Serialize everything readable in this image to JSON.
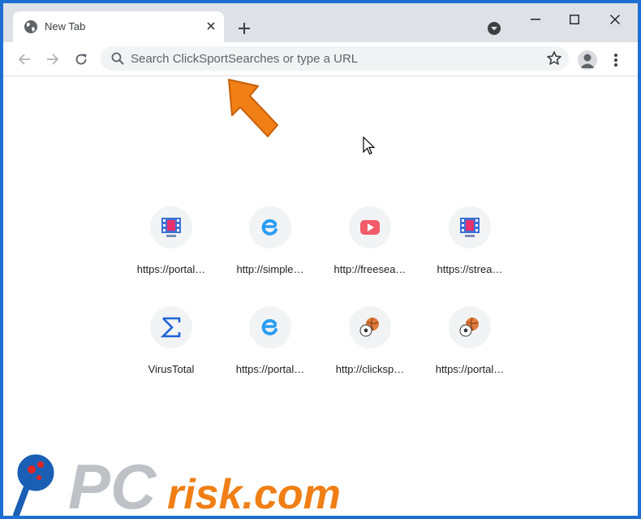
{
  "browser": {
    "tab": {
      "title": "New Tab"
    },
    "omnibox": {
      "placeholder": "Search ClickSportSearches or type a URL"
    }
  },
  "shortcuts": [
    {
      "label": "https://portal…",
      "icon": "film-monitor-icon"
    },
    {
      "label": "http://simple…",
      "icon": "blue-e-icon"
    },
    {
      "label": "http://freesea…",
      "icon": "play-button-icon"
    },
    {
      "label": "https://strea…",
      "icon": "film-monitor-icon"
    },
    {
      "label": "VirusTotal",
      "icon": "sigma-icon"
    },
    {
      "label": "https://portal…",
      "icon": "blue-e-icon"
    },
    {
      "label": "http://clicksp…",
      "icon": "sports-balls-icon"
    },
    {
      "label": "https://portal…",
      "icon": "sports-balls-icon"
    }
  ],
  "watermark": {
    "text": "PCrisk.com"
  },
  "colors": {
    "window_frame": "#1e6fd0",
    "tabstrip": "#dee1e6",
    "omnibox": "#f1f3f4",
    "annotation_arrow": "#f07f16"
  }
}
